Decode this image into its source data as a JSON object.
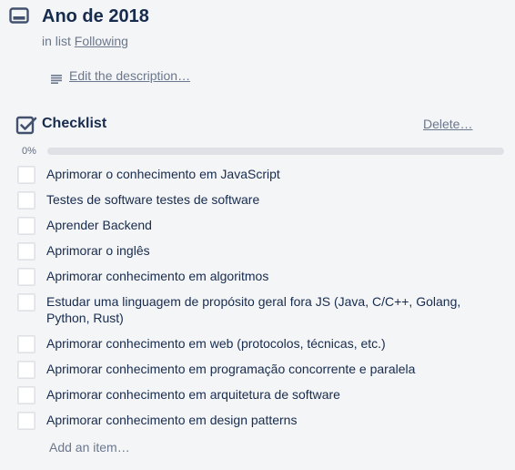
{
  "card": {
    "title": "Ano de 2018",
    "in_list_prefix": "in list",
    "list_name": "Following"
  },
  "description": {
    "edit_label": "Edit the description…"
  },
  "checklist": {
    "title": "Checklist",
    "delete_label": "Delete…",
    "progress_text": "0%",
    "progress_fraction": 0,
    "items": [
      {
        "text": "Aprimorar o conhecimento em JavaScript",
        "checked": false
      },
      {
        "text": "Testes de software testes de software",
        "checked": false
      },
      {
        "text": "Aprender Backend",
        "checked": false
      },
      {
        "text": "Aprimorar o inglês",
        "checked": false
      },
      {
        "text": "Aprimorar conhecimento em algoritmos",
        "checked": false
      },
      {
        "text": "Estudar uma linguagem de propósito geral fora JS (Java, C/C++, Golang, Python, Rust)",
        "checked": false
      },
      {
        "text": "Aprimorar conhecimento em web (protocolos, técnicas, etc.)",
        "checked": false
      },
      {
        "text": "Aprimorar conhecimento em programação concorrente e paralela",
        "checked": false
      },
      {
        "text": "Aprimorar conhecimento em arquitetura de software",
        "checked": false
      },
      {
        "text": "Aprimorar conhecimento em design patterns",
        "checked": false
      }
    ],
    "add_item_label": "Add an item…"
  },
  "colors": {
    "text": "#172b4d",
    "muted": "#6b778c",
    "background": "#f4f5f7",
    "progress_track": "#dfe1e6",
    "progress_fill": "#61bd4f"
  },
  "icons": {
    "card": "card-icon",
    "description": "description-icon",
    "checklist": "checklist-icon"
  }
}
